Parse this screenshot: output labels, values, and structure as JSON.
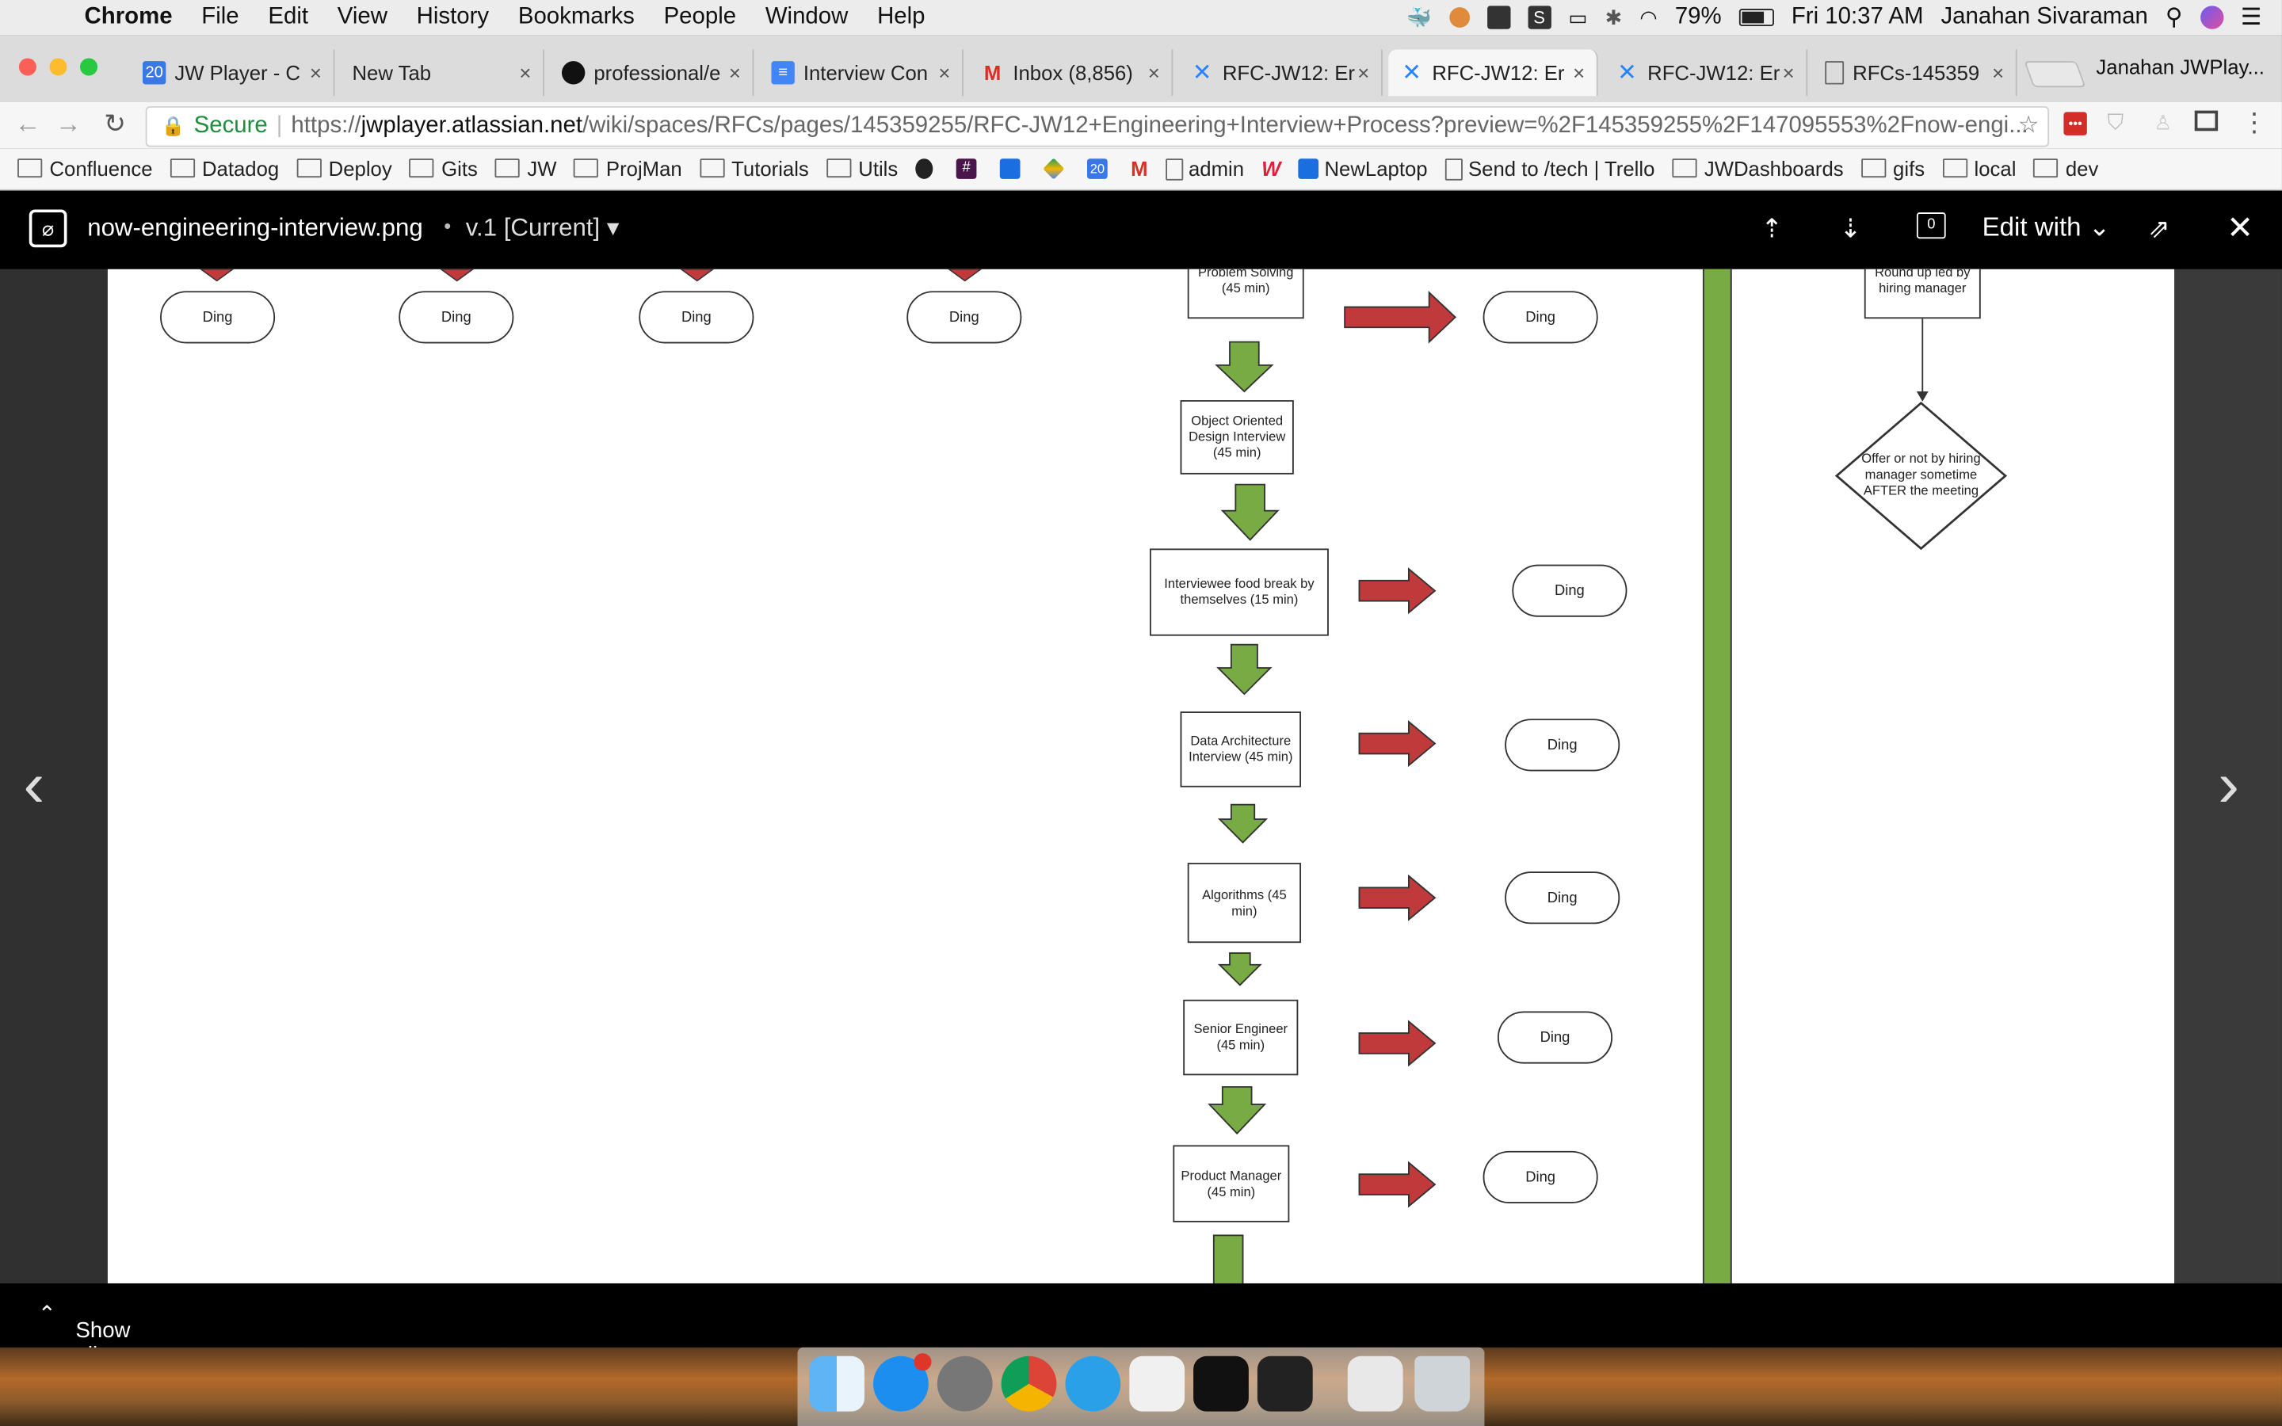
{
  "menubar": {
    "app": "Chrome",
    "items": [
      "File",
      "Edit",
      "View",
      "History",
      "Bookmarks",
      "People",
      "Window",
      "Help"
    ],
    "battery": "79%",
    "clock": "Fri 10:37 AM",
    "user": "Janahan Sivaraman"
  },
  "tabs": [
    {
      "label": "JW Player - C",
      "icon_color": "#3b78e7",
      "icon": "20"
    },
    {
      "label": "New Tab",
      "icon_color": "",
      "icon": ""
    },
    {
      "label": "professional/e",
      "icon_color": "#111",
      "icon": "gh"
    },
    {
      "label": "Interview Con",
      "icon_color": "#4285f4",
      "icon": "doc"
    },
    {
      "label": "Inbox (8,856)",
      "icon_color": "#d93025",
      "icon": "M"
    },
    {
      "label": "RFC-JW12: Er",
      "icon_color": "#2684ff",
      "icon": "conf"
    },
    {
      "label": "RFC-JW12: Er",
      "icon_color": "#2684ff",
      "icon": "conf"
    },
    {
      "label": "RFC-JW12: Er",
      "icon_color": "#2684ff",
      "icon": "conf"
    },
    {
      "label": "RFCs-145359",
      "icon_color": "#666",
      "icon": "page"
    }
  ],
  "profile_name": "Janahan JWPlay...",
  "address": {
    "secure_label": "Secure",
    "scheme": "https://",
    "host": "jwplayer.atlassian.net",
    "path": "/wiki/spaces/RFCs/pages/145359255/RFC-JW12+Engineering+Interview+Process?preview=%2F145359255%2F147095553%2Fnow-engi..."
  },
  "bookmarks": [
    "Confluence",
    "Datadog",
    "Deploy",
    "Gits",
    "JW",
    "ProjMan",
    "Tutorials",
    "Utils",
    "admin",
    "NewLaptop",
    "Send to /tech | Trello",
    "JWDashboards",
    "gifs",
    "local",
    "dev"
  ],
  "viewer": {
    "filename": "now-engineering-interview.png",
    "separator": "•",
    "version": "v.1 [Current]",
    "edit_with": "Edit with",
    "comment_count": "0"
  },
  "diagram": {
    "top_dings": [
      "Ding",
      "Ding",
      "Ding",
      "Ding"
    ],
    "steps": [
      {
        "label": "Problem Solving (45 min)",
        "ding": "Ding"
      },
      {
        "label": "Object Oriented Design Interview (45 min)",
        "ding": ""
      },
      {
        "label": "Interviewee food break by themselves (15 min)",
        "ding": "Ding"
      },
      {
        "label": "Data Architecture Interview (45 min)",
        "ding": "Ding"
      },
      {
        "label": "Algorithms (45 min)",
        "ding": "Ding"
      },
      {
        "label": "Senior Engineer (45 min)",
        "ding": "Ding"
      },
      {
        "label": "Product Manager (45 min)",
        "ding": "Ding"
      }
    ],
    "roundup": "Round up led by hiring manager",
    "decision": "Offer or not by hiring manager sometime AFTER the meeting",
    "colors": {
      "green": "#79ab45",
      "red": "#c0393b"
    }
  },
  "footer": {
    "show_all": "Show all files"
  }
}
